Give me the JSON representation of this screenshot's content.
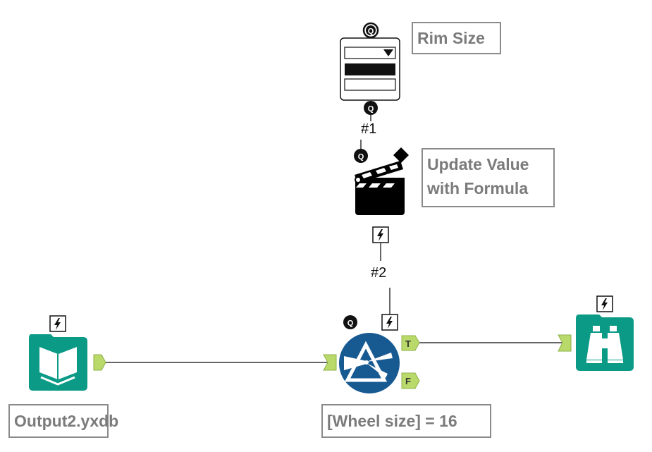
{
  "canvas": {
    "type": "workflow",
    "connection_color": "#555555",
    "anchor_color": "#b9d96a",
    "tool_teal": "#0a9a86",
    "filter_blue": "#175a92"
  },
  "tools": {
    "dropdown": {
      "name": "Drop Down",
      "annotation": "Rim Size",
      "input_anchor": "Q",
      "output_anchor": "Q"
    },
    "action": {
      "name": "Action",
      "annotation_line1": "Update Value",
      "annotation_line2": "with Formula",
      "input_anchor": "Q"
    },
    "input": {
      "name": "Input Data",
      "annotation": "Output2.yxdb"
    },
    "filter": {
      "name": "Filter",
      "annotation": "[Wheel size] = 16",
      "input_anchor": "Q",
      "true_anchor": "T",
      "false_anchor": "F"
    },
    "browse": {
      "name": "Browse"
    }
  },
  "connections": [
    {
      "label": "#1",
      "from": "dropdown",
      "to": "action"
    },
    {
      "label": "#2",
      "from": "action",
      "to": "filter"
    },
    {
      "label": "",
      "from": "input",
      "to": "filter"
    },
    {
      "label": "",
      "from": "filter.T",
      "to": "browse"
    }
  ]
}
